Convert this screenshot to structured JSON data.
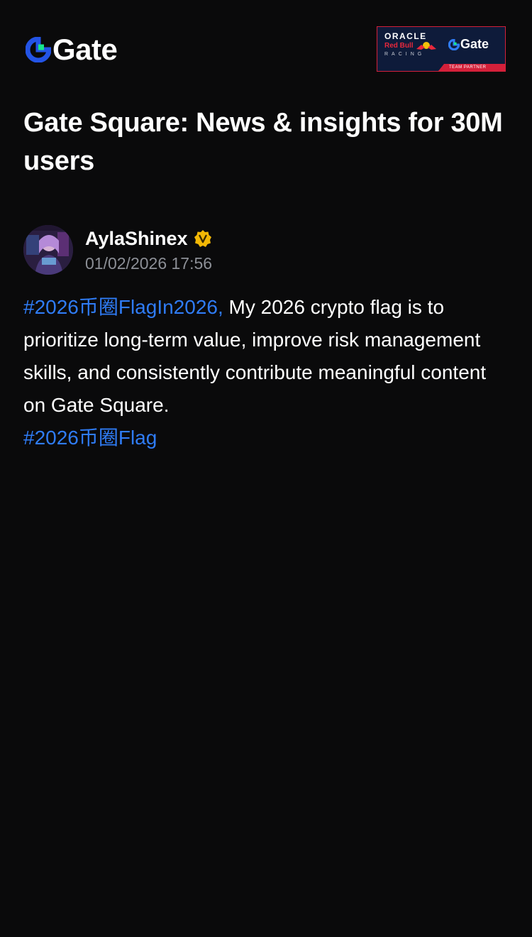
{
  "header": {
    "brand_name": "Gate",
    "partner_badge": {
      "oracle": "ORACLE",
      "redbull": "Red Bull",
      "racing": "RACING",
      "gate": "Gate",
      "team_partner": "TEAM PARTNER"
    }
  },
  "page": {
    "title": "Gate Square: News & insights for 30M users"
  },
  "post": {
    "author": {
      "name": "AylaShinex",
      "verified_icon": "verified-badge-icon",
      "timestamp": "01/02/2026 17:56"
    },
    "hashtag_1": "#2026币圈FlagIn2026,",
    "text": " My 2026 crypto flag is to prioritize long-term value, improve risk management skills, and consistently contribute meaningful content on Gate Square.",
    "hashtag_2": "#2026币圈Flag"
  },
  "colors": {
    "background": "#0a0a0b",
    "brand_blue": "#2354e6",
    "brand_green": "#17e68a",
    "hashtag": "#2f7cf6",
    "verified": "#f2b705",
    "muted_text": "#8c8f96"
  }
}
